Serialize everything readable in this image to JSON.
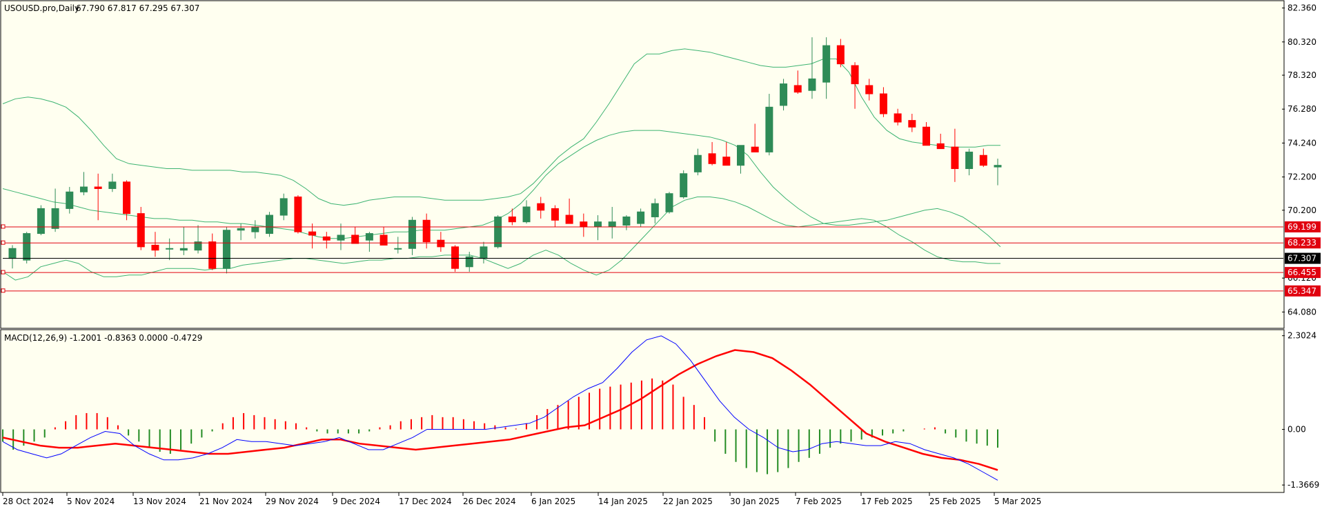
{
  "chart_data": [
    {
      "type": "candlestick",
      "header": {
        "symbol": "USOUSD.pro,Daily",
        "ohlc": "67.790 67.817 67.295 67.307"
      },
      "ylim": [
        63.1,
        82.8
      ],
      "y_ticks": [
        "82.360",
        "80.320",
        "78.320",
        "76.280",
        "74.240",
        "72.200",
        "70.200",
        "66.120",
        "64.080"
      ],
      "y_tick_values": [
        82.36,
        80.32,
        78.32,
        76.28,
        74.24,
        72.2,
        70.2,
        66.12,
        64.08
      ],
      "price_lines": [
        {
          "label": "69.199",
          "value": 69.199,
          "color": "#e0000f"
        },
        {
          "label": "68.233",
          "value": 68.233,
          "color": "#e0000f"
        },
        {
          "label": "66.455",
          "value": 66.455,
          "color": "#e0000f"
        },
        {
          "label": "65.347",
          "value": 65.347,
          "color": "#e0000f"
        }
      ],
      "current_price": {
        "label": "67.307",
        "value": 67.307
      },
      "bollinger": {
        "upper": [
          76.6,
          76.9,
          77.0,
          76.9,
          76.7,
          76.4,
          75.8,
          75.0,
          74.1,
          73.3,
          73.0,
          72.9,
          72.8,
          72.7,
          72.7,
          72.6,
          72.6,
          72.6,
          72.6,
          72.5,
          72.5,
          72.4,
          72.3,
          72.0,
          71.5,
          70.9,
          70.6,
          70.5,
          70.6,
          70.8,
          70.9,
          71.0,
          71.0,
          71.0,
          70.9,
          70.8,
          70.8,
          70.8,
          70.8,
          70.9,
          71.0,
          71.2,
          71.8,
          72.6,
          73.4,
          74.0,
          74.5,
          75.5,
          76.6,
          77.8,
          79.0,
          79.6,
          79.6,
          79.8,
          79.9,
          79.8,
          79.7,
          79.5,
          79.3,
          79.1,
          78.9,
          78.8,
          78.8,
          78.9,
          79.0,
          79.3,
          79.3,
          78.5,
          77.0,
          75.8,
          75.0,
          74.5,
          74.3,
          74.2,
          74.1,
          74.0,
          74.0,
          74.0,
          74.1,
          74.1
        ],
        "middle": [
          71.5,
          71.3,
          71.1,
          70.9,
          70.7,
          70.6,
          70.4,
          70.2,
          70.1,
          70.0,
          69.9,
          69.8,
          69.7,
          69.7,
          69.6,
          69.6,
          69.5,
          69.5,
          69.4,
          69.4,
          69.3,
          69.2,
          69.1,
          69.0,
          68.8,
          68.6,
          68.5,
          68.5,
          68.6,
          68.7,
          68.8,
          68.9,
          68.9,
          69.0,
          69.0,
          69.0,
          69.1,
          69.2,
          69.3,
          69.6,
          70.0,
          70.6,
          71.4,
          72.3,
          73.0,
          73.5,
          74.0,
          74.4,
          74.7,
          74.9,
          75.0,
          75.0,
          75.0,
          74.9,
          74.8,
          74.7,
          74.6,
          74.4,
          74.1,
          73.5,
          72.5,
          71.6,
          70.9,
          70.3,
          69.8,
          69.4,
          69.3,
          69.3,
          69.4,
          69.5,
          69.6,
          69.8,
          70.0,
          70.2,
          70.3,
          70.1,
          69.8,
          69.3,
          68.7,
          68.0
        ],
        "lower": [
          66.5,
          66.0,
          66.2,
          66.8,
          67.0,
          67.2,
          67.0,
          66.5,
          66.2,
          66.2,
          66.3,
          66.3,
          66.5,
          66.7,
          66.7,
          66.7,
          66.6,
          66.7,
          66.7,
          66.9,
          67.0,
          67.1,
          67.2,
          67.3,
          67.3,
          67.2,
          67.1,
          67.0,
          67.1,
          67.2,
          67.2,
          67.3,
          67.3,
          67.4,
          67.4,
          67.5,
          67.5,
          67.5,
          67.3,
          67.0,
          66.7,
          67.0,
          67.5,
          67.8,
          67.5,
          67.0,
          66.6,
          66.3,
          66.6,
          67.2,
          68.0,
          68.8,
          69.6,
          70.4,
          70.8,
          71.0,
          71.0,
          70.9,
          70.7,
          70.4,
          70.0,
          69.6,
          69.3,
          69.2,
          69.3,
          69.4,
          69.5,
          69.6,
          69.7,
          69.6,
          69.2,
          68.7,
          68.3,
          67.8,
          67.4,
          67.2,
          67.1,
          67.1,
          67.0,
          67.0
        ]
      },
      "candles": [
        {
          "o": 67.3,
          "h": 68.1,
          "l": 66.7,
          "c": 67.9
        },
        {
          "o": 67.2,
          "h": 68.9,
          "l": 67.0,
          "c": 68.8
        },
        {
          "o": 68.8,
          "h": 70.5,
          "l": 68.7,
          "c": 70.3
        },
        {
          "o": 69.1,
          "h": 71.5,
          "l": 68.9,
          "c": 70.3
        },
        {
          "o": 70.3,
          "h": 71.6,
          "l": 70.0,
          "c": 71.3
        },
        {
          "o": 71.3,
          "h": 72.5,
          "l": 71.1,
          "c": 71.6
        },
        {
          "o": 71.6,
          "h": 72.4,
          "l": 69.6,
          "c": 71.5
        },
        {
          "o": 71.5,
          "h": 72.4,
          "l": 71.3,
          "c": 71.9
        },
        {
          "o": 71.9,
          "h": 72.0,
          "l": 69.6,
          "c": 70.0
        },
        {
          "o": 70.0,
          "h": 70.4,
          "l": 67.8,
          "c": 68.0
        },
        {
          "o": 68.1,
          "h": 68.9,
          "l": 67.4,
          "c": 67.8
        },
        {
          "o": 67.9,
          "h": 68.5,
          "l": 67.2,
          "c": 67.9
        },
        {
          "o": 67.8,
          "h": 69.2,
          "l": 67.5,
          "c": 67.9
        },
        {
          "o": 67.8,
          "h": 69.3,
          "l": 67.6,
          "c": 68.3
        },
        {
          "o": 68.3,
          "h": 68.8,
          "l": 66.6,
          "c": 66.7
        },
        {
          "o": 66.7,
          "h": 69.2,
          "l": 66.4,
          "c": 69.0
        },
        {
          "o": 69.0,
          "h": 69.4,
          "l": 68.4,
          "c": 69.1
        },
        {
          "o": 68.9,
          "h": 69.6,
          "l": 68.5,
          "c": 69.2
        },
        {
          "o": 68.8,
          "h": 70.1,
          "l": 68.6,
          "c": 69.9
        },
        {
          "o": 69.9,
          "h": 71.2,
          "l": 69.6,
          "c": 70.9
        },
        {
          "o": 71.0,
          "h": 71.1,
          "l": 68.8,
          "c": 68.9
        },
        {
          "o": 68.9,
          "h": 69.4,
          "l": 67.9,
          "c": 68.7
        },
        {
          "o": 68.6,
          "h": 68.9,
          "l": 67.9,
          "c": 68.4
        },
        {
          "o": 68.4,
          "h": 69.4,
          "l": 67.8,
          "c": 68.7
        },
        {
          "o": 68.7,
          "h": 69.2,
          "l": 68.2,
          "c": 68.2
        },
        {
          "o": 68.4,
          "h": 68.9,
          "l": 67.7,
          "c": 68.8
        },
        {
          "o": 68.7,
          "h": 69.2,
          "l": 68.1,
          "c": 68.1
        },
        {
          "o": 67.9,
          "h": 68.6,
          "l": 67.6,
          "c": 67.9
        },
        {
          "o": 67.9,
          "h": 69.8,
          "l": 67.5,
          "c": 69.6
        },
        {
          "o": 69.6,
          "h": 70.0,
          "l": 67.9,
          "c": 68.3
        },
        {
          "o": 68.4,
          "h": 68.9,
          "l": 67.7,
          "c": 68.0
        },
        {
          "o": 68.0,
          "h": 68.1,
          "l": 66.5,
          "c": 66.7
        },
        {
          "o": 66.8,
          "h": 67.7,
          "l": 66.5,
          "c": 67.4
        },
        {
          "o": 67.3,
          "h": 68.3,
          "l": 67.0,
          "c": 68.0
        },
        {
          "o": 68.0,
          "h": 69.9,
          "l": 67.9,
          "c": 69.8
        },
        {
          "o": 69.8,
          "h": 70.3,
          "l": 69.3,
          "c": 69.5
        },
        {
          "o": 69.5,
          "h": 70.8,
          "l": 69.4,
          "c": 70.4
        },
        {
          "o": 70.6,
          "h": 71.0,
          "l": 69.7,
          "c": 70.2
        },
        {
          "o": 70.3,
          "h": 70.5,
          "l": 69.2,
          "c": 69.6
        },
        {
          "o": 69.9,
          "h": 70.9,
          "l": 69.4,
          "c": 69.4
        },
        {
          "o": 69.5,
          "h": 70.0,
          "l": 68.6,
          "c": 69.2
        },
        {
          "o": 69.2,
          "h": 69.9,
          "l": 68.4,
          "c": 69.5
        },
        {
          "o": 69.2,
          "h": 70.4,
          "l": 68.5,
          "c": 69.5
        },
        {
          "o": 69.3,
          "h": 69.9,
          "l": 69.0,
          "c": 69.8
        },
        {
          "o": 69.4,
          "h": 70.3,
          "l": 69.2,
          "c": 70.1
        },
        {
          "o": 69.8,
          "h": 70.9,
          "l": 69.4,
          "c": 70.6
        },
        {
          "o": 70.1,
          "h": 71.3,
          "l": 70.0,
          "c": 71.2
        },
        {
          "o": 71.0,
          "h": 72.6,
          "l": 70.9,
          "c": 72.4
        },
        {
          "o": 72.5,
          "h": 73.9,
          "l": 72.3,
          "c": 73.5
        },
        {
          "o": 73.6,
          "h": 74.3,
          "l": 72.9,
          "c": 73.0
        },
        {
          "o": 73.4,
          "h": 74.3,
          "l": 72.9,
          "c": 72.9
        },
        {
          "o": 72.9,
          "h": 74.1,
          "l": 72.4,
          "c": 74.1
        },
        {
          "o": 74.0,
          "h": 75.4,
          "l": 73.7,
          "c": 73.7
        },
        {
          "o": 73.7,
          "h": 77.2,
          "l": 73.5,
          "c": 76.4
        },
        {
          "o": 76.5,
          "h": 78.1,
          "l": 76.2,
          "c": 77.8
        },
        {
          "o": 77.7,
          "h": 78.6,
          "l": 77.2,
          "c": 77.3
        },
        {
          "o": 77.4,
          "h": 80.6,
          "l": 76.9,
          "c": 78.1
        },
        {
          "o": 77.9,
          "h": 80.6,
          "l": 76.9,
          "c": 80.1
        },
        {
          "o": 80.1,
          "h": 80.5,
          "l": 78.8,
          "c": 79.0
        },
        {
          "o": 78.9,
          "h": 79.1,
          "l": 76.3,
          "c": 77.8
        },
        {
          "o": 77.7,
          "h": 78.1,
          "l": 76.8,
          "c": 77.2
        },
        {
          "o": 77.2,
          "h": 77.6,
          "l": 75.8,
          "c": 76.0
        },
        {
          "o": 76.0,
          "h": 76.3,
          "l": 75.3,
          "c": 75.5
        },
        {
          "o": 75.6,
          "h": 76.0,
          "l": 74.9,
          "c": 75.2
        },
        {
          "o": 75.2,
          "h": 75.5,
          "l": 74.8,
          "c": 74.1
        },
        {
          "o": 74.2,
          "h": 74.8,
          "l": 73.9,
          "c": 73.9
        },
        {
          "o": 74.0,
          "h": 75.1,
          "l": 71.9,
          "c": 72.7
        },
        {
          "o": 72.7,
          "h": 73.9,
          "l": 72.3,
          "c": 73.7
        },
        {
          "o": 73.5,
          "h": 73.9,
          "l": 72.8,
          "c": 72.9
        },
        {
          "o": 72.8,
          "h": 73.3,
          "l": 71.7,
          "c": 72.9
        }
      ],
      "x_labels": [
        "28 Oct 2024",
        "5 Nov 2024",
        "13 Nov 2024",
        "21 Nov 2024",
        "29 Nov 2024",
        "9 Dec 2024",
        "17 Dec 2024",
        "26 Dec 2024",
        "6 Jan 2025",
        "14 Jan 2025",
        "22 Jan 2025",
        "30 Jan 2025",
        "7 Feb 2025",
        "17 Feb 2025",
        "25 Feb 2025",
        "5 Mar 2025"
      ]
    },
    {
      "type": "macd",
      "header": "MACD(12,26,9) -1.2001 -0.8363 0.0000 -0.4729",
      "ylim": [
        -1.55,
        2.45
      ],
      "y_ticks": [
        "2.3024",
        "0.00",
        "-1.3669"
      ],
      "y_tick_values": [
        2.3024,
        0.0,
        -1.3669
      ],
      "histogram": [
        -0.3,
        -0.5,
        -0.4,
        -0.3,
        -0.2,
        0.05,
        0.2,
        0.35,
        0.4,
        0.4,
        0.3,
        0.1,
        -0.15,
        -0.3,
        -0.45,
        -0.55,
        -0.6,
        -0.5,
        -0.35,
        -0.2,
        -0.05,
        0.15,
        0.3,
        0.4,
        0.35,
        0.3,
        0.25,
        0.2,
        0.15,
        0.05,
        -0.05,
        -0.1,
        -0.1,
        -0.1,
        -0.1,
        -0.05,
        0.05,
        0.1,
        0.2,
        0.25,
        0.3,
        0.35,
        0.3,
        0.3,
        0.25,
        0.2,
        0.15,
        0.1,
        0.05,
        0.02,
        0.15,
        0.35,
        0.5,
        0.6,
        0.7,
        0.8,
        0.9,
        1.0,
        1.05,
        1.1,
        1.15,
        1.2,
        1.25,
        1.2,
        1.1,
        0.8,
        0.6,
        0.3,
        -0.3,
        -0.6,
        -0.8,
        -0.95,
        -1.05,
        -1.1,
        -1.05,
        -0.95,
        -0.8,
        -0.7,
        -0.6,
        -0.45,
        -0.35,
        -0.3,
        -0.25,
        -0.2,
        -0.15,
        -0.1,
        -0.05,
        0.0,
        0.02,
        0.05,
        -0.1,
        -0.2,
        -0.3,
        -0.35,
        -0.4,
        -0.45
      ],
      "macd_line": [
        -0.3,
        -0.5,
        -0.6,
        -0.7,
        -0.6,
        -0.4,
        -0.2,
        -0.05,
        -0.1,
        -0.4,
        -0.6,
        -0.75,
        -0.75,
        -0.7,
        -0.6,
        -0.45,
        -0.25,
        -0.3,
        -0.3,
        -0.35,
        -0.4,
        -0.35,
        -0.3,
        -0.2,
        -0.35,
        -0.5,
        -0.5,
        -0.35,
        -0.2,
        0.0,
        0.0,
        0.0,
        0.0,
        0.0,
        0.05,
        0.1,
        0.15,
        0.3,
        0.55,
        0.8,
        1.0,
        1.15,
        1.5,
        1.9,
        2.2,
        2.3,
        2.1,
        1.7,
        1.2,
        0.7,
        0.3,
        0.0,
        -0.2,
        -0.45,
        -0.55,
        -0.5,
        -0.35,
        -0.3,
        -0.35,
        -0.4,
        -0.4,
        -0.3,
        -0.35,
        -0.5,
        -0.6,
        -0.7,
        -0.85,
        -1.05,
        -1.25
      ],
      "signal_line": [
        -0.2,
        -0.3,
        -0.4,
        -0.45,
        -0.45,
        -0.4,
        -0.35,
        -0.4,
        -0.45,
        -0.5,
        -0.55,
        -0.6,
        -0.6,
        -0.55,
        -0.5,
        -0.45,
        -0.35,
        -0.25,
        -0.25,
        -0.35,
        -0.4,
        -0.45,
        -0.5,
        -0.45,
        -0.4,
        -0.35,
        -0.3,
        -0.25,
        -0.15,
        -0.05,
        0.05,
        0.1,
        0.3,
        0.5,
        0.75,
        1.05,
        1.35,
        1.6,
        1.8,
        1.95,
        1.9,
        1.75,
        1.45,
        1.1,
        0.7,
        0.3,
        -0.1,
        -0.3,
        -0.45,
        -0.6,
        -0.7,
        -0.75,
        -0.85,
        -1.0
      ],
      "x_labels": [
        "28 Oct 2024",
        "5 Nov 2024",
        "13 Nov 2024",
        "21 Nov 2024",
        "29 Nov 2024",
        "9 Dec 2024",
        "17 Dec 2024",
        "26 Dec 2024",
        "6 Jan 2025",
        "14 Jan 2025",
        "22 Jan 2025",
        "30 Jan 2025",
        "7 Feb 2025",
        "17 Feb 2025",
        "25 Feb 2025",
        "5 Mar 2025"
      ]
    }
  ],
  "colors": {
    "background": "#fffff0",
    "bull": "#2e8b57",
    "bear": "#ff0000",
    "band": "#3cb371",
    "price_line": "#ff0000",
    "current_line": "#000000",
    "macd_hist_pos": "#ff0000",
    "macd_hist_neg": "#228b22",
    "macd_line": "#0000ff",
    "signal_line": "#ff0000"
  }
}
